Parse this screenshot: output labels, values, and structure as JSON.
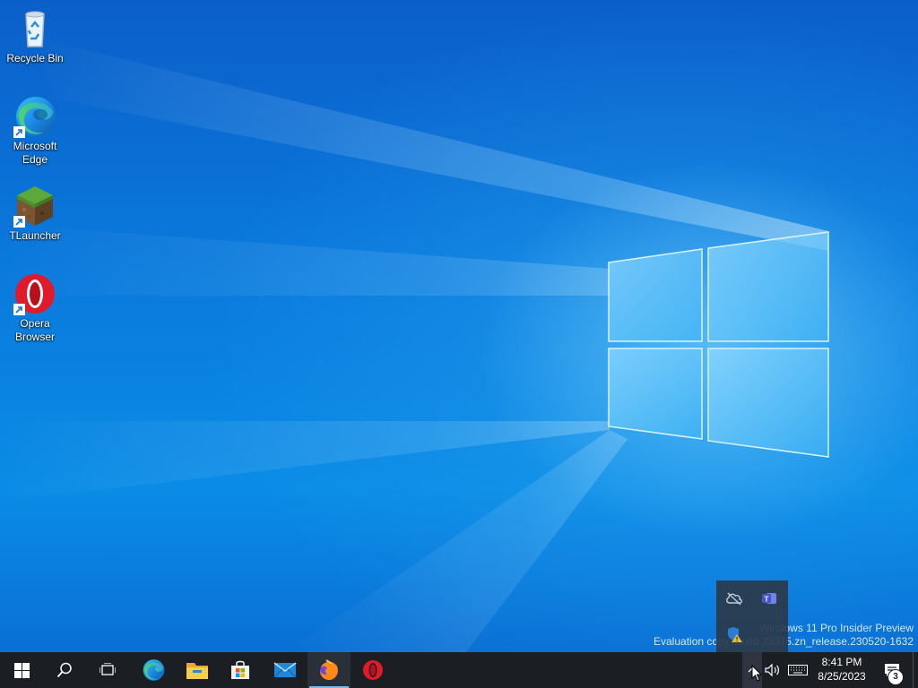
{
  "desktop": {
    "icons": [
      {
        "label": "Recycle Bin",
        "icon": "recycle-bin-icon"
      },
      {
        "label": "Microsoft\nEdge",
        "icon": "edge-icon",
        "shortcut": true
      },
      {
        "label": "TLauncher",
        "icon": "tlauncher-grass-block-icon",
        "shortcut": true
      },
      {
        "label": "Opera\nBrowser",
        "icon": "opera-icon",
        "shortcut": true
      }
    ],
    "watermark": {
      "line1": "Windows 11 Pro Insider Preview",
      "line2": "Evaluation copy. Build 23375.zn_release.230520-1632"
    }
  },
  "tray_flyout": {
    "icons": [
      "onedrive-offline-icon",
      "teams-icon",
      "security-warning-icon"
    ]
  },
  "taskbar": {
    "buttons": [
      {
        "name": "start-button",
        "icon": "windows-logo-icon"
      },
      {
        "name": "search-button",
        "icon": "search-icon"
      },
      {
        "name": "task-view-button",
        "icon": "task-view-icon"
      },
      {
        "name": "taskbar-edge",
        "icon": "edge-icon"
      },
      {
        "name": "taskbar-file-explorer",
        "icon": "folder-icon"
      },
      {
        "name": "taskbar-store",
        "icon": "store-icon"
      },
      {
        "name": "taskbar-mail",
        "icon": "mail-icon"
      },
      {
        "name": "taskbar-firefox",
        "icon": "firefox-icon",
        "active": true
      },
      {
        "name": "taskbar-opera",
        "icon": "opera-icon"
      }
    ],
    "tray": {
      "chevron_icon": "chevron-up-icon",
      "volume_icon": "volume-icon",
      "keyboard_icon": "touch-keyboard-icon",
      "time": "8:41 PM",
      "date": "8/25/2023",
      "notification_count": "3"
    }
  },
  "colors": {
    "taskbar_bg": "#1b1f24",
    "active_indicator": "#76b9ed",
    "desktop_blue": "#0a79dc"
  }
}
